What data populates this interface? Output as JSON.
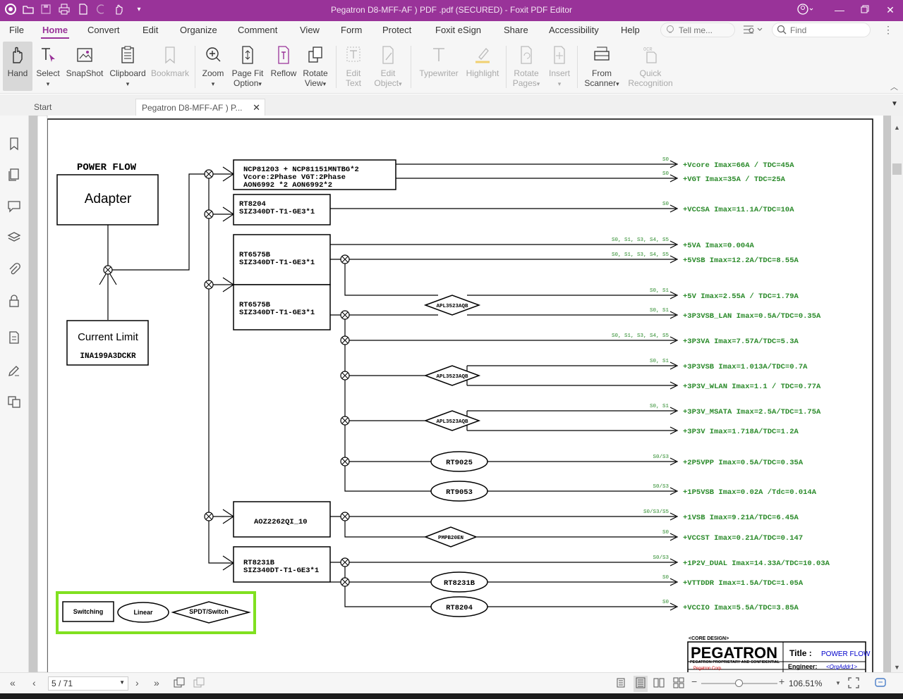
{
  "window": {
    "title": "Pegatron D8-MFF-AF ) PDF .pdf (SECURED) - Foxit PDF Editor"
  },
  "menu": {
    "items": [
      "File",
      "Home",
      "Convert",
      "Edit",
      "Organize",
      "Comment",
      "View",
      "Form",
      "Protect",
      "Foxit eSign",
      "Share",
      "Accessibility",
      "Help"
    ],
    "tell_me_placeholder": "Tell me...",
    "find_placeholder": "Find"
  },
  "ribbon": {
    "hand": "Hand",
    "select": "Select",
    "snapshot": "SnapShot",
    "clipboard": "Clipboard",
    "bookmark": "Bookmark",
    "zoom": "Zoom",
    "page_fit_1": "Page Fit",
    "page_fit_2": "Option",
    "reflow": "Reflow",
    "rotate_1": "Rotate",
    "rotate_2": "View",
    "edit_text_1": "Edit",
    "edit_text_2": "Text",
    "edit_object_1": "Edit",
    "edit_object_2": "Object",
    "typewriter": "Typewriter",
    "highlight": "Highlight",
    "rotate_pages_1": "Rotate",
    "rotate_pages_2": "Pages",
    "insert": "Insert",
    "from_scanner_1": "From",
    "from_scanner_2": "Scanner",
    "quick_recog_1": "Quick",
    "quick_recog_2": "Recognition"
  },
  "tabs": {
    "start": "Start",
    "doc": "Pegatron D8-MFF-AF ) P..."
  },
  "schematic": {
    "heading": "POWER FLOW",
    "adapter": "Adapter",
    "current_limit": "Current Limit",
    "current_limit_ic": "INA199A3DCKR",
    "blocks": {
      "ncp_1": "NCP81203 + NCP81151MNTBG*2",
      "ncp_2": "Vcore:2Phase  VGT:2Phase",
      "ncp_3": "AON6992 *2  AON6992*2",
      "rt8204_1": "RT8204",
      "rt8204_2": "SIZ340DT-T1-GE3*1",
      "rt6575a_1": "RT6575B",
      "rt6575a_2": "SIZ340DT-T1-GE3*1",
      "rt6575b_1": "RT6575B",
      "rt6575b_2": "SIZ340DT-T1-GE3*1",
      "aoz": "AOZ2262QI_10",
      "rt8231_1": "RT8231B",
      "rt8231_2": "SIZ340DT-T1-GE3*1"
    },
    "switches": {
      "apl1": "APL3523AQB",
      "apl2": "APL3523AQB",
      "apl3": "APL3523AQB",
      "pmpb": "PMPB20EN"
    },
    "linears": {
      "rt9025": "RT9025",
      "rt9053": "RT9053",
      "rt8231b": "RT8231B",
      "rt8204": "RT8204"
    },
    "rails": [
      {
        "state": "S0",
        "label": "+Vcore  Imax=66A / TDC=45A"
      },
      {
        "state": "S0",
        "label": "+VGT    Imax=35A / TDC=25A"
      },
      {
        "state": "S0",
        "label": "+VCCSA Imax=11.1A/TDC=10A"
      },
      {
        "state": "S0, S1, S3, S4, S5",
        "label": "+5VA   Imax=0.004A"
      },
      {
        "state": "S0, S1, S3, S4, S5",
        "label": "+5VSB   Imax=12.2A/TDC=8.55A"
      },
      {
        "state": "S0, S1",
        "label": "+5V Imax=2.55A / TDC=1.79A"
      },
      {
        "state": "S0, S1",
        "label": "+3P3VSB_LAN  Imax=0.5A/TDC=0.35A"
      },
      {
        "state": "S0, S1, S3, S4, S5",
        "label": "+3P3VA Imax=7.57A/TDC=5.3A"
      },
      {
        "state": "S0, S1",
        "label": "+3P3VSB  Imax=1.013A/TDC=0.7A"
      },
      {
        "state": "",
        "label": "+3P3V_WLAN   Imax=1.1 / TDC=0.77A"
      },
      {
        "state": "S0, S1",
        "label": "+3P3V_MSATA  Imax=2.5A/TDC=1.75A"
      },
      {
        "state": "",
        "label": "+3P3V  Imax=1.718A/TDC=1.2A"
      },
      {
        "state": "S0/S3",
        "label": "+2P5VPP  Imax=0.5A/TDC=0.35A"
      },
      {
        "state": "S0/S3",
        "label": "+1P5VSB  Imax=0.02A /Tdc=0.014A"
      },
      {
        "state": "S0/S3/S5",
        "label": "+1VSB  Imax=9.21A/TDC=6.45A"
      },
      {
        "state": "S0",
        "label": "+VCCST  Imax=0.21A/TDC=0.147"
      },
      {
        "state": "S0/S3",
        "label": "+1P2V_DUAL   Imax=14.33A/TDC=10.03A"
      },
      {
        "state": "S0",
        "label": "+VTTDDR  Imax=1.5A/TDC=1.05A"
      },
      {
        "state": "S0",
        "label": "+VCCIO   Imax=5.5A/TDC=3.85A"
      }
    ],
    "legend": {
      "switching": "Switching",
      "linear": "Linear",
      "spdt": "SPDT/Switch"
    },
    "titleblock": {
      "core": "<CORE DESIGN>",
      "logo": "PEGATRON",
      "title_label": "Title :",
      "title_value": "POWER FLOW",
      "confidential": "PEGATRON PROPRIETARY AND CONFIDENTIAL",
      "corp": "Pegatron Corp.",
      "engineer_label": "Engineer:",
      "engineer_value": "<OrgAddr1>"
    }
  },
  "status": {
    "page": "5 / 71",
    "zoom": "106.51%"
  },
  "colors": {
    "brand": "#993399",
    "rail_text": "#2a8a2a",
    "legend_border": "#80e020"
  }
}
